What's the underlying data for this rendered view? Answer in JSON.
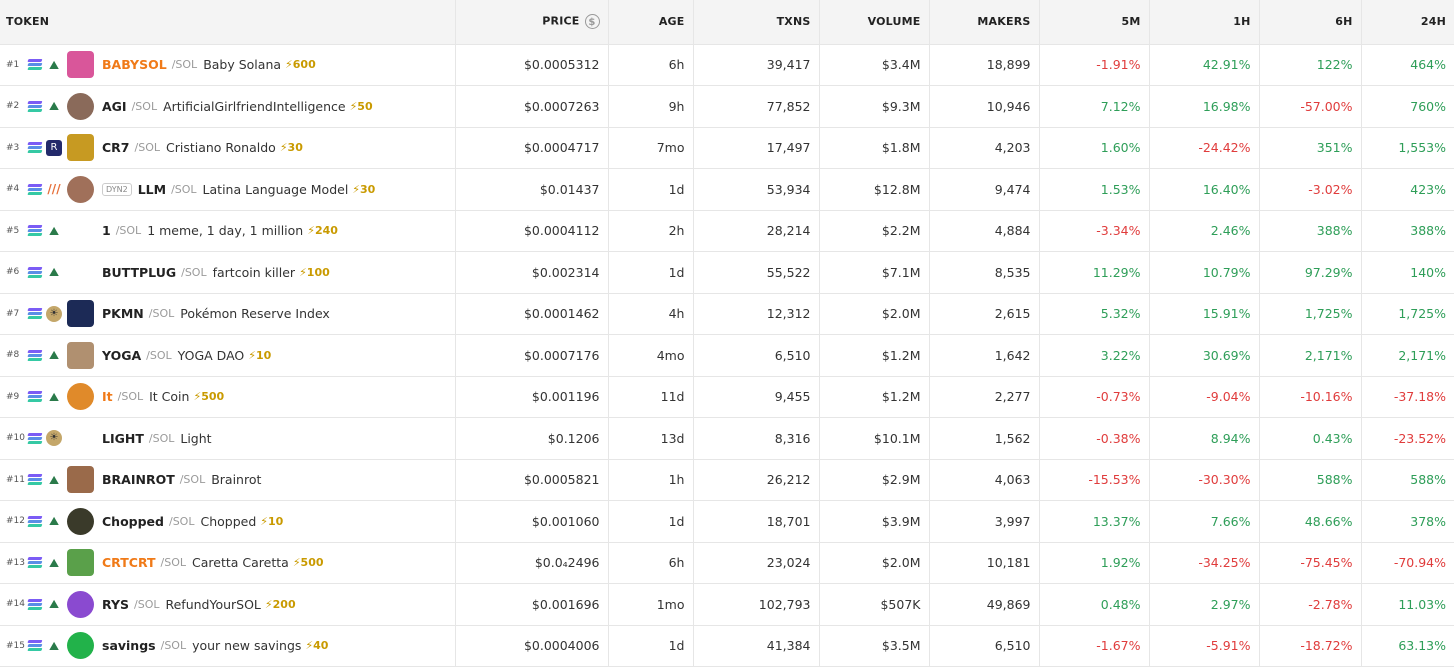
{
  "headers": {
    "token": "TOKEN",
    "price": "PRICE",
    "age": "AGE",
    "txns": "TXNS",
    "volume": "VOLUME",
    "makers": "MAKERS",
    "m5": "5M",
    "h1": "1H",
    "h6": "6H",
    "h24": "24H"
  },
  "rows": [
    {
      "rank": "#1",
      "symbol": "BABYSOL",
      "chain": "/SOL",
      "name": "Baby Solana",
      "boost": "⚡600",
      "price": "$0.0005312",
      "age": "6h",
      "txns": "39,417",
      "volume": "$3.4M",
      "makers": "18,899",
      "m5": "-1.91%",
      "h1": "42.91%",
      "h6": "122%",
      "h24": "464%"
    },
    {
      "rank": "#2",
      "symbol": "AGI",
      "chain": "/SOL",
      "name": "ArtificialGirlfriendIntelligence",
      "boost": "⚡50",
      "price": "$0.0007263",
      "age": "9h",
      "txns": "77,852",
      "volume": "$9.3M",
      "makers": "10,946",
      "m5": "7.12%",
      "h1": "16.98%",
      "h6": "-57.00%",
      "h24": "760%"
    },
    {
      "rank": "#3",
      "symbol": "CR7",
      "chain": "/SOL",
      "name": "Cristiano Ronaldo",
      "boost": "⚡30",
      "price": "$0.0004717",
      "age": "7mo",
      "txns": "17,497",
      "volume": "$1.8M",
      "makers": "4,203",
      "m5": "1.60%",
      "h1": "-24.42%",
      "h6": "351%",
      "h24": "1,553%"
    },
    {
      "rank": "#4",
      "tag": "DYN2",
      "symbol": "LLM",
      "chain": "/SOL",
      "name": "Latina Language Model",
      "boost": "⚡30",
      "price": "$0.01437",
      "age": "1d",
      "txns": "53,934",
      "volume": "$12.8M",
      "makers": "9,474",
      "m5": "1.53%",
      "h1": "16.40%",
      "h6": "-3.02%",
      "h24": "423%"
    },
    {
      "rank": "#5",
      "symbol": "1",
      "chain": "/SOL",
      "name": "1 meme, 1 day, 1 million",
      "boost": "⚡240",
      "price": "$0.0004112",
      "age": "2h",
      "txns": "28,214",
      "volume": "$2.2M",
      "makers": "4,884",
      "m5": "-3.34%",
      "h1": "2.46%",
      "h6": "388%",
      "h24": "388%"
    },
    {
      "rank": "#6",
      "symbol": "BUTTPLUG",
      "chain": "/SOL",
      "name": "fartcoin killer",
      "boost": "⚡100",
      "price": "$0.002314",
      "age": "1d",
      "txns": "55,522",
      "volume": "$7.1M",
      "makers": "8,535",
      "m5": "11.29%",
      "h1": "10.79%",
      "h6": "97.29%",
      "h24": "140%"
    },
    {
      "rank": "#7",
      "symbol": "PKMN",
      "chain": "/SOL",
      "name": "Pokémon Reserve Index",
      "boost": "",
      "price": "$0.0001462",
      "age": "4h",
      "txns": "12,312",
      "volume": "$2.0M",
      "makers": "2,615",
      "m5": "5.32%",
      "h1": "15.91%",
      "h6": "1,725%",
      "h24": "1,725%"
    },
    {
      "rank": "#8",
      "symbol": "YOGA",
      "chain": "/SOL",
      "name": "YOGA DAO",
      "boost": "⚡10",
      "price": "$0.0007176",
      "age": "4mo",
      "txns": "6,510",
      "volume": "$1.2M",
      "makers": "1,642",
      "m5": "3.22%",
      "h1": "30.69%",
      "h6": "2,171%",
      "h24": "2,171%"
    },
    {
      "rank": "#9",
      "symbol": "It",
      "chain": "/SOL",
      "name": "It Coin",
      "boost": "⚡500",
      "price": "$0.001196",
      "age": "11d",
      "txns": "9,455",
      "volume": "$1.2M",
      "makers": "2,277",
      "m5": "-0.73%",
      "h1": "-9.04%",
      "h6": "-10.16%",
      "h24": "-37.18%"
    },
    {
      "rank": "#10",
      "symbol": "LIGHT",
      "chain": "/SOL",
      "name": "Light",
      "boost": "",
      "price": "$0.1206",
      "age": "13d",
      "txns": "8,316",
      "volume": "$10.1M",
      "makers": "1,562",
      "m5": "-0.38%",
      "h1": "8.94%",
      "h6": "0.43%",
      "h24": "-23.52%"
    },
    {
      "rank": "#11",
      "symbol": "BRAINROT",
      "chain": "/SOL",
      "name": "Brainrot",
      "boost": "",
      "price": "$0.0005821",
      "age": "1h",
      "txns": "26,212",
      "volume": "$2.9M",
      "makers": "4,063",
      "m5": "-15.53%",
      "h1": "-30.30%",
      "h6": "588%",
      "h24": "588%"
    },
    {
      "rank": "#12",
      "symbol": "Chopped",
      "chain": "/SOL",
      "name": "Chopped",
      "boost": "⚡10",
      "price": "$0.001060",
      "age": "1d",
      "txns": "18,701",
      "volume": "$3.9M",
      "makers": "3,997",
      "m5": "13.37%",
      "h1": "7.66%",
      "h6": "48.66%",
      "h24": "378%"
    },
    {
      "rank": "#13",
      "symbol": "CRTCRT",
      "chain": "/SOL",
      "name": "Caretta Caretta",
      "boost": "⚡500",
      "price": "$0.0₄2496",
      "age": "6h",
      "txns": "23,024",
      "volume": "$2.0M",
      "makers": "10,181",
      "m5": "1.92%",
      "h1": "-34.25%",
      "h6": "-75.45%",
      "h24": "-70.94%"
    },
    {
      "rank": "#14",
      "symbol": "RYS",
      "chain": "/SOL",
      "name": "RefundYourSOL",
      "boost": "⚡200",
      "price": "$0.001696",
      "age": "1mo",
      "txns": "102,793",
      "volume": "$507K",
      "makers": "49,869",
      "m5": "0.48%",
      "h1": "2.97%",
      "h6": "-2.78%",
      "h24": "11.03%"
    },
    {
      "rank": "#15",
      "symbol": "savings",
      "chain": "/SOL",
      "name": "your new savings",
      "boost": "⚡40",
      "price": "$0.0004006",
      "age": "1d",
      "txns": "41,384",
      "volume": "$3.5M",
      "makers": "6,510",
      "m5": "-1.67%",
      "h1": "-5.91%",
      "h6": "-18.72%",
      "h24": "63.13%"
    }
  ],
  "row_styles": [
    {
      "dex": "raydium-icon",
      "avatar": "#d9569a",
      "circle": false,
      "hot": true
    },
    {
      "dex": "raydium-icon",
      "avatar": "#8a6a5a",
      "circle": true,
      "hot": false
    },
    {
      "dex": "rd-icon",
      "avatar": "#c79a22",
      "circle": false,
      "hot": false
    },
    {
      "dex": "bars-icon",
      "avatar": "#a0705a",
      "circle": true,
      "hot": false
    },
    {
      "dex": "raydium-icon",
      "avatar": "",
      "circle": false,
      "hot": false
    },
    {
      "dex": "raydium-icon",
      "avatar": "",
      "circle": false,
      "hot": false
    },
    {
      "dex": "sun-icon",
      "avatar": "#1c2a56",
      "circle": false,
      "hot": false
    },
    {
      "dex": "raydium-icon",
      "avatar": "#b09070",
      "circle": false,
      "hot": false
    },
    {
      "dex": "raydium-icon",
      "avatar": "#e08a2a",
      "circle": true,
      "hot": true
    },
    {
      "dex": "sun-icon",
      "avatar": "",
      "circle": false,
      "hot": false
    },
    {
      "dex": "raydium-icon",
      "avatar": "#9a6a4a",
      "circle": false,
      "hot": false
    },
    {
      "dex": "raydium-icon",
      "avatar": "#3a3a2a",
      "circle": true,
      "hot": false
    },
    {
      "dex": "raydium-icon",
      "avatar": "#5aa04a",
      "circle": false,
      "hot": true
    },
    {
      "dex": "raydium-icon",
      "avatar": "#8a4ad0",
      "circle": true,
      "hot": false
    },
    {
      "dex": "raydium-icon",
      "avatar": "#22b24a",
      "circle": true,
      "hot": false
    }
  ]
}
